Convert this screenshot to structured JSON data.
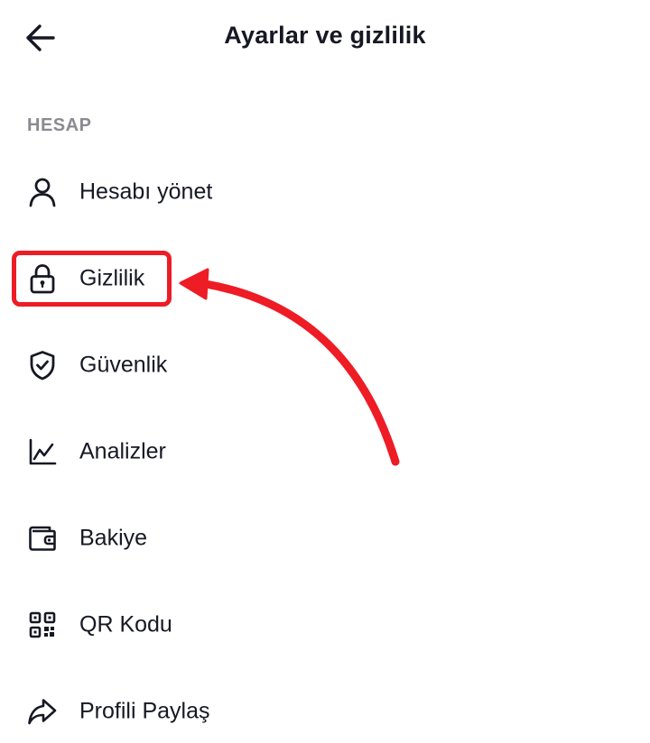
{
  "header": {
    "title": "Ayarlar ve gizlilik",
    "back_icon": "arrow-left-icon"
  },
  "section": {
    "label": "HESAP"
  },
  "menu": [
    {
      "id": "manage-account",
      "label": "Hesabı yönet",
      "icon": "person-icon"
    },
    {
      "id": "privacy",
      "label": "Gizlilik",
      "icon": "lock-icon"
    },
    {
      "id": "security",
      "label": "Güvenlik",
      "icon": "shield-check-icon"
    },
    {
      "id": "analytics",
      "label": "Analizler",
      "icon": "line-chart-icon"
    },
    {
      "id": "balance",
      "label": "Bakiye",
      "icon": "wallet-icon"
    },
    {
      "id": "qr-code",
      "label": "QR Kodu",
      "icon": "qr-code-icon"
    },
    {
      "id": "share-profile",
      "label": "Profili Paylaş",
      "icon": "share-icon"
    }
  ],
  "annotation": {
    "highlighted_item": "privacy",
    "color": "#ee1c25"
  },
  "colors": {
    "text": "#161823",
    "section_label": "#8a8b91",
    "background": "#ffffff",
    "annotation": "#ee1c25"
  }
}
